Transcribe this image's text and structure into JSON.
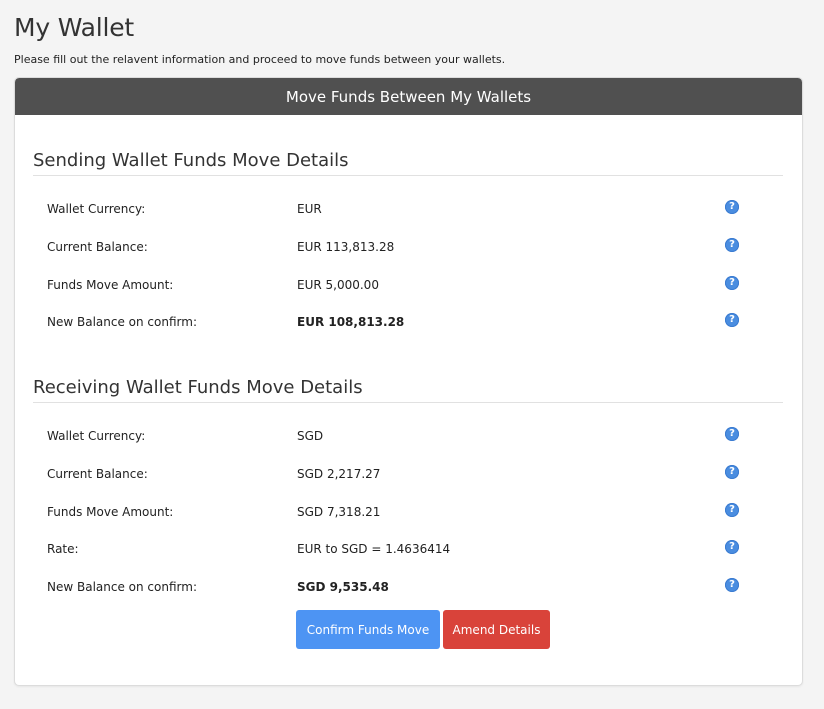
{
  "page": {
    "title": "My Wallet",
    "subtitle": "Please fill out the relavent information and proceed to move funds between your wallets."
  },
  "panel": {
    "header": "Move Funds Between My Wallets"
  },
  "sending": {
    "heading": "Sending Wallet Funds Move Details",
    "rows": [
      {
        "label": "Wallet Currency:",
        "value": "EUR"
      },
      {
        "label": "Current Balance:",
        "value": "EUR 113,813.28"
      },
      {
        "label": "Funds Move Amount:",
        "value": "EUR 5,000.00"
      },
      {
        "label": "New Balance on confirm:",
        "value": "EUR 108,813.28"
      }
    ]
  },
  "receiving": {
    "heading": "Receiving Wallet Funds Move Details",
    "rows": [
      {
        "label": "Wallet Currency:",
        "value": "SGD"
      },
      {
        "label": "Current Balance:",
        "value": "SGD 2,217.27"
      },
      {
        "label": "Funds Move Amount:",
        "value": "SGD 7,318.21"
      },
      {
        "label": "Rate:",
        "value": "EUR to SGD = 1.4636414"
      },
      {
        "label": "New Balance on confirm:",
        "value": "SGD 9,535.48"
      }
    ]
  },
  "help_icon": {
    "glyph": "?",
    "icon": "question-icon",
    "color": "#4a8de0"
  },
  "actions": {
    "confirm_label": "Confirm Funds Move",
    "amend_label": "Amend Details",
    "confirm_color": "#4d94f3",
    "amend_color": "#d9433a"
  }
}
